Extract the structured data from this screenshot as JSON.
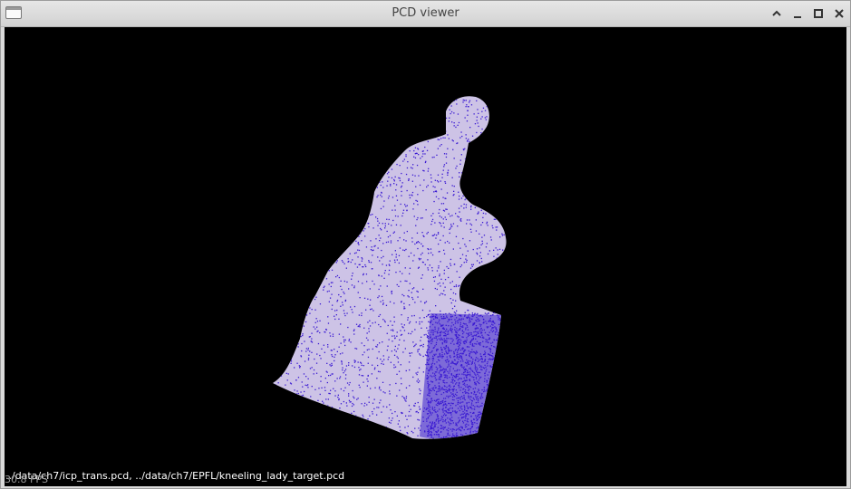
{
  "window": {
    "title": "PCD viewer",
    "controls": [
      {
        "name": "shade",
        "icon": "chevron-up-icon"
      },
      {
        "name": "minimize",
        "icon": "minimize-icon"
      },
      {
        "name": "maximize",
        "icon": "maximize-icon"
      },
      {
        "name": "close",
        "icon": "close-icon"
      }
    ]
  },
  "viewer": {
    "background_color": "#000000",
    "cloud_colors": {
      "surface": "#cdc3e6",
      "points": "#3a19d2"
    },
    "status_text": "../data/ch7/icp_trans.pcd, ../data/ch7/EPFL/kneeling_lady_target.pcd",
    "fps_text": "30.8 FPS"
  }
}
